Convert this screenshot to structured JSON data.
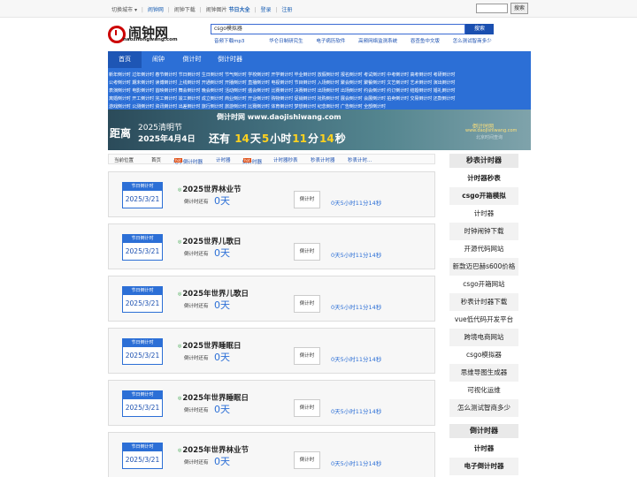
{
  "topbar": {
    "city": "切换城市",
    "links": [
      "闹钟网",
      "闹钟下载",
      "闹钟图片"
    ],
    "highlight": "节日大全",
    "login": "登录",
    "register": "注册",
    "search_button": "搜索"
  },
  "header": {
    "logo_title": "闹钟网",
    "logo_domain": "naozhongwang.com",
    "search_value": "csgo模拟器",
    "search_button": "搜索",
    "hot_links": [
      "音频下载mp3",
      "华仑日制研究生",
      "电子病历软件",
      "高频网络监测系统",
      "吞查鱼中文版",
      "怎么测试智商多少"
    ]
  },
  "nav": [
    "首页",
    "闹钟",
    "倒计时",
    "倒计时器"
  ],
  "categories": [
    "新年倒计时 过年倒计时 春节倒计时 节日倒计时 生日倒计时 节气倒计时 学校倒计时 开学倒计时 毕业倒计时 放假倒计时 报名倒计时 考试倒计时 中考倒计时 高考倒计时 考研倒计时",
    "公考倒计时 期末倒计时 读博倒计时 上线倒计时 开通倒计时 开播倒计时 直播倒计时 电视倒计时 节目倒计时 入场倒计时 聚会倒计时 聚餐倒计时 文艺倒计时 艺术倒计时 演出倒计时",
    "表演倒计时 电影倒计时 首映倒计时 舞会倒计时 晚会倒计时 活动倒计时 盛会倒计时 比赛倒计时 决赛倒计时 出场倒计时 出场倒计时 约会倒计时 约订倒计时 结婚倒计时 婚礼倒计时",
    "离婚倒计时 开工倒计时 完工倒计时 竣工倒计时 成立倒计时 商业倒计时 开业倒计时 购物倒计时 促销倒计时 抢购倒计时 展会倒计时 会展倒计时 拍卖倒计时 交易倒计时 还款倒计时",
    "游戏倒计时 公测倒计时 资讯倒计时 出差倒计时 旅行倒计时 旅游倒计时 比赛倒计时 体育倒计时 梦想倒计时 纪念倒计时 广告倒计时 全部倒计时"
  ],
  "banner": {
    "site": "倒计时网 www.daojishiwang.com",
    "label": "距离",
    "festival": "2025清明节",
    "date": "2025年4月4日",
    "prefix": "还有",
    "days": "14",
    "days_unit": "天",
    "hours": "5",
    "hours_unit": "小时",
    "minutes": "11",
    "minutes_unit": "分",
    "seconds": "14",
    "seconds_unit": "秒",
    "right_title": "倒计时网",
    "right_url": "www.daojishiwang.com",
    "right_sub": "北京时间查询"
  },
  "breadcrumb": {
    "label": "当前位置",
    "home": "首页",
    "links": [
      "电子倒计时器",
      "计时器",
      "倒计时器",
      "计时器秒表",
      "秒表计时器",
      "秒表计时..."
    ]
  },
  "list": [
    {
      "badge": "节日倒计时",
      "date": "2025/3/21",
      "title": "2025世界林业节",
      "label": "倒计时还有",
      "days": "0",
      "unit": "天",
      "button": "倒计时",
      "remaining": "0天5小时11分14秒"
    },
    {
      "badge": "节日倒计时",
      "date": "2025/3/21",
      "title": "2025世界儿歌日",
      "label": "倒计时还有",
      "days": "0",
      "unit": "天",
      "button": "倒计时",
      "remaining": "0天5小时11分14秒"
    },
    {
      "badge": "节日倒计时",
      "date": "2025/3/21",
      "title": "2025年世界儿歌日",
      "label": "倒计时还有",
      "days": "0",
      "unit": "天",
      "button": "倒计时",
      "remaining": "0天5小时11分14秒"
    },
    {
      "badge": "节日倒计时",
      "date": "2025/3/21",
      "title": "2025世界睡眠日",
      "label": "倒计时还有",
      "days": "0",
      "unit": "天",
      "button": "倒计时",
      "remaining": "0天5小时11分14秒"
    },
    {
      "badge": "节日倒计时",
      "date": "2025/3/21",
      "title": "2025年世界睡眠日",
      "label": "倒计时还有",
      "days": "0",
      "unit": "天",
      "button": "倒计时",
      "remaining": "0天5小时11分14秒"
    },
    {
      "badge": "节日倒计时",
      "date": "2025/3/21",
      "title": "2025年世界林业节",
      "label": "倒计时还有",
      "days": "0",
      "unit": "天",
      "button": "倒计时",
      "remaining": "0天5小时11分14秒"
    }
  ],
  "sidebar": {
    "section1_title": "秒表计时器",
    "section1_items": [
      "计时器秒表",
      "csgo开箱模拟",
      "计时器",
      "时钟闹钟下载",
      "开源代码网站",
      "新款迈巴赫s600价格",
      "csgo开箱网站",
      "秒表计时器下载",
      "vue低代码开发平台",
      "跨境电商网站",
      "csgo模拟器",
      "思维导图生成器",
      "可视化运维",
      "怎么测试智商多少"
    ],
    "section2_title": "倒计时器",
    "section2_items": [
      "计时器",
      "电子倒计时器"
    ]
  }
}
